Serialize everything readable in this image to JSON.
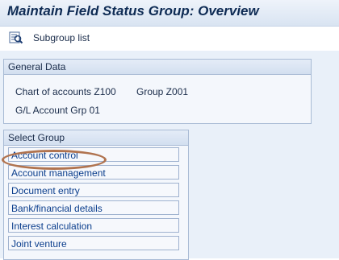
{
  "title": "Maintain Field Status Group: Overview",
  "toolbar": {
    "subgroup_label": "Subgroup list",
    "subgroup_icon": "search-list-icon"
  },
  "general_data": {
    "header": "General Data",
    "chart_of_accounts": "Chart of accounts Z100",
    "group": "Group Z001",
    "gl_account_grp": "G/L Account Grp 01"
  },
  "select_group": {
    "header": "Select Group",
    "items": [
      "Account control",
      "Account management",
      "Document entry",
      "Bank/financial details",
      "Interest calculation",
      "Joint venture"
    ]
  },
  "colors": {
    "title": "#0e2b54",
    "link_text": "#0a3d8c",
    "highlight_ring": "#b0734f",
    "panel_bg": "#e9f0f9"
  }
}
